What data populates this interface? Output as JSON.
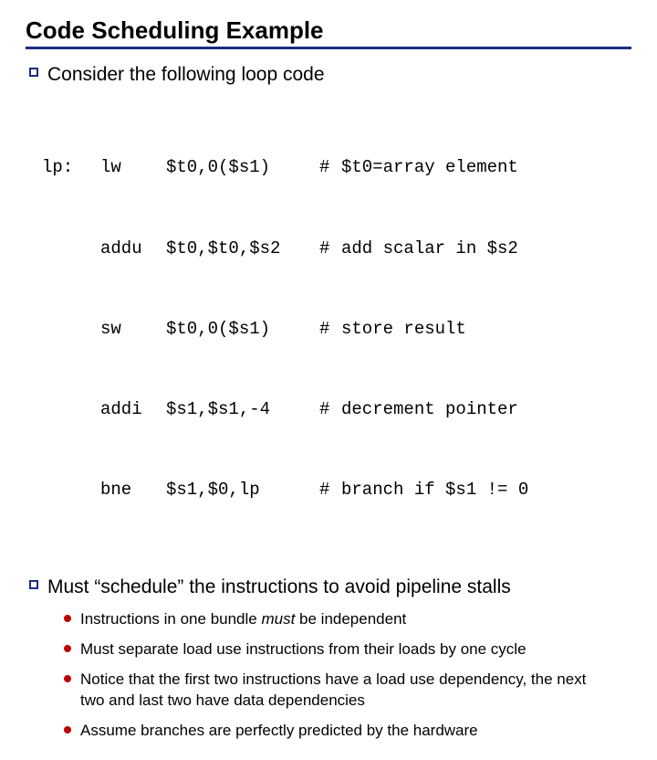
{
  "title": "Code Scheduling Example",
  "consider": "Consider the following loop code",
  "code": {
    "label": "lp:",
    "rows": [
      {
        "op": "lw",
        "args": "$t0,0($s1)",
        "hash": "#",
        "cmt": "$t0=array element"
      },
      {
        "op": "addu",
        "args": "$t0,$t0,$s2",
        "hash": "#",
        "cmt": "add scalar in $s2"
      },
      {
        "op": "sw",
        "args": "$t0,0($s1)",
        "hash": "#",
        "cmt": "store result"
      },
      {
        "op": "addi",
        "args": "$s1,$s1,-4",
        "hash": "#",
        "cmt": "decrement pointer"
      },
      {
        "op": "bne",
        "args": "$s1,$0,lp",
        "hash": "#",
        "cmt": "branch if $s1 != 0"
      }
    ]
  },
  "must_pre": "Must “schedule” the instructions to avoid pipeline stalls",
  "sub": {
    "b1_a": "Instructions in one bundle ",
    "b1_i": "must",
    "b1_b": " be independent",
    "b2": "Must separate load use instructions from their loads by one cycle",
    "b3": "Notice that the first two instructions have a load use dependency, the next two and last two have data dependencies",
    "b4": "Assume branches are perfectly predicted by the hardware"
  }
}
